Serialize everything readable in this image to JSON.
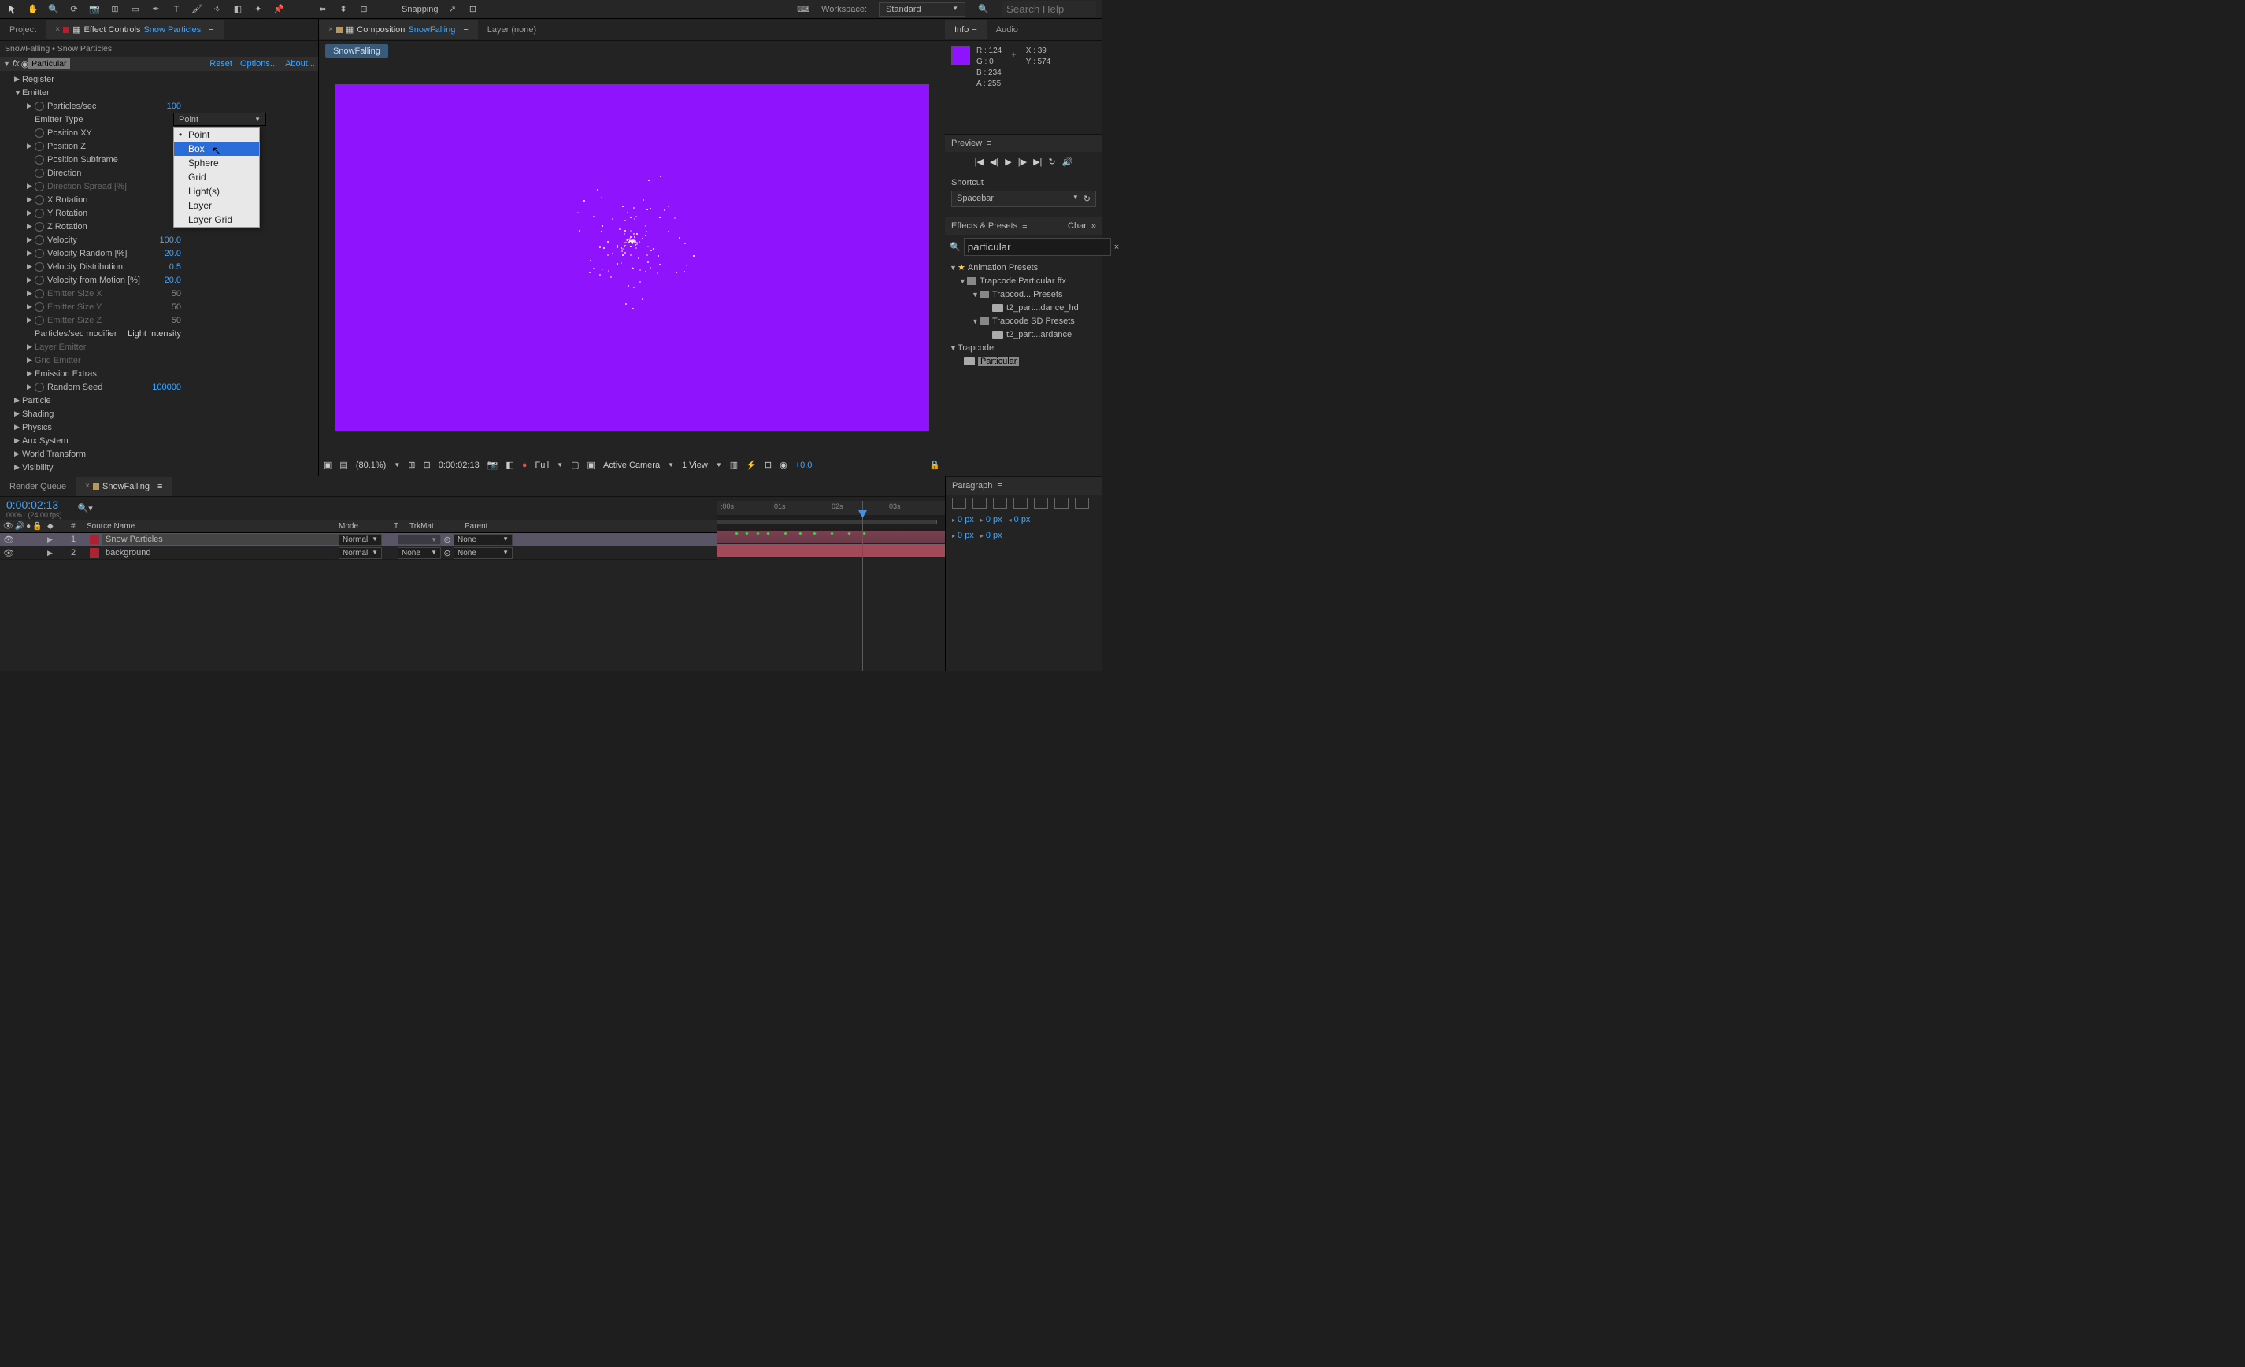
{
  "toolbar": {
    "snapping": "Snapping",
    "workspace_label": "Workspace:",
    "workspace_value": "Standard",
    "search_placeholder": "Search Help"
  },
  "left_panel": {
    "project_tab": "Project",
    "effect_controls_tab": "Effect Controls",
    "effect_controls_layer": "Snow Particles",
    "breadcrumb": "SnowFalling • Snow Particles",
    "effect_name": "Particular",
    "reset": "Reset",
    "options": "Options...",
    "about": "About...",
    "groups": {
      "register": "Register",
      "emitter": "Emitter",
      "particle": "Particle",
      "shading": "Shading",
      "physics": "Physics",
      "aux": "Aux System",
      "world": "World Transform",
      "visibility": "Visibility"
    },
    "props": {
      "particles_sec": {
        "label": "Particles/sec",
        "value": "100"
      },
      "emitter_type": {
        "label": "Emitter Type",
        "value": "Point"
      },
      "position_xy": {
        "label": "Position XY"
      },
      "position_z": {
        "label": "Position Z"
      },
      "position_subframe": {
        "label": "Position Subframe"
      },
      "direction": {
        "label": "Direction"
      },
      "direction_spread": {
        "label": "Direction Spread [%]"
      },
      "x_rotation": {
        "label": "X Rotation"
      },
      "y_rotation": {
        "label": "Y Rotation"
      },
      "z_rotation": {
        "label": "Z Rotation"
      },
      "velocity": {
        "label": "Velocity",
        "value": "100.0"
      },
      "velocity_random": {
        "label": "Velocity Random [%]",
        "value": "20.0"
      },
      "velocity_distribution": {
        "label": "Velocity Distribution",
        "value": "0.5"
      },
      "velocity_motion": {
        "label": "Velocity from Motion [%]",
        "value": "20.0"
      },
      "emitter_size_x": {
        "label": "Emitter Size X",
        "value": "50"
      },
      "emitter_size_y": {
        "label": "Emitter Size Y",
        "value": "50"
      },
      "emitter_size_z": {
        "label": "Emitter Size Z",
        "value": "50"
      },
      "psec_modifier": {
        "label": "Particles/sec modifier",
        "value": "Light Intensity"
      },
      "layer_emitter": {
        "label": "Layer Emitter"
      },
      "grid_emitter": {
        "label": "Grid Emitter"
      },
      "emission_extras": {
        "label": "Emission Extras"
      },
      "random_seed": {
        "label": "Random Seed",
        "value": "100000"
      }
    },
    "dropdown_options": [
      "Point",
      "Box",
      "Sphere",
      "Grid",
      "Light(s)",
      "Layer",
      "Layer Grid"
    ]
  },
  "center": {
    "composition_tab": "Composition",
    "composition_name": "SnowFalling",
    "layer_tab": "Layer (none)",
    "breadcrumb": "SnowFalling",
    "viewer_bar": {
      "zoom": "(80.1%)",
      "time": "0:00:02:13",
      "res": "Full",
      "camera": "Active Camera",
      "view": "1 View",
      "exposure": "+0.0"
    }
  },
  "right": {
    "info_tab": "Info",
    "audio_tab": "Audio",
    "info": {
      "r": "R : 124",
      "g": "G : 0",
      "b": "B : 234",
      "a": "A : 255",
      "x": "X : 39",
      "y": "Y : 574"
    },
    "preview_tab": "Preview",
    "shortcut_label": "Shortcut",
    "shortcut_value": "Spacebar",
    "effects_presets_tab": "Effects & Presets",
    "char_tab": "Char",
    "search_value": "particular",
    "tree": {
      "anim_presets": "Animation Presets",
      "trapcode_ffx": "Trapcode Particular ffx",
      "trapcod_presets": "Trapcod... Presets",
      "t2_dance": "t2_part...dance_hd",
      "trapcode_sd": "Trapcode SD Presets",
      "t2_ardance": "t2_part...ardance",
      "trapcode": "Trapcode",
      "particular": "Particular"
    }
  },
  "timeline": {
    "render_queue_tab": "Render Queue",
    "comp_tab": "SnowFalling",
    "timecode": "0:00:02:13",
    "timecode_sub": "00061 (24.00 fps)",
    "cols": {
      "num": "#",
      "source": "Source Name",
      "mode": "Mode",
      "t": "T",
      "trkmat": "TrkMat",
      "parent": "Parent"
    },
    "layers": [
      {
        "num": "1",
        "name": "Snow Particles",
        "color": "#b02030",
        "mode": "Normal",
        "trkmat": "",
        "parent": "None"
      },
      {
        "num": "2",
        "name": "background",
        "color": "#b02030",
        "mode": "Normal",
        "trkmat": "None",
        "parent": "None"
      }
    ],
    "ruler": [
      ":00s",
      "01s",
      "02s",
      "03s"
    ]
  },
  "paragraph": {
    "tab": "Paragraph",
    "px": "0 px"
  }
}
